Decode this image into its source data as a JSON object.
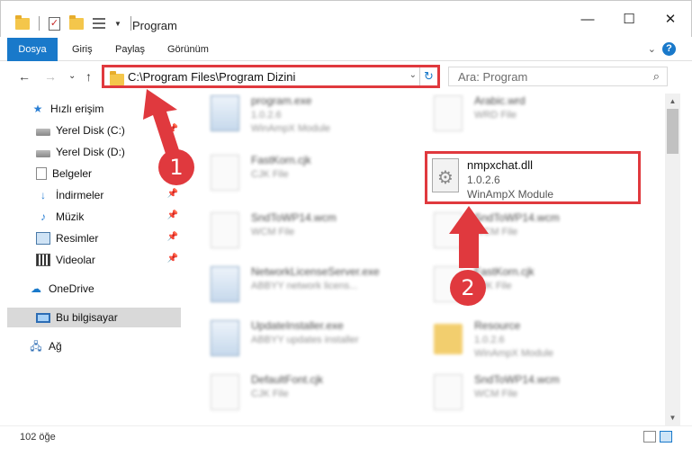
{
  "window": {
    "title": "Program",
    "minimize": "—",
    "maximize": "☐",
    "close": "✕"
  },
  "ribbon": {
    "tabs": [
      "Dosya",
      "Giriş",
      "Paylaş",
      "Görünüm"
    ],
    "collapse": "⌄",
    "help": "?"
  },
  "nav": {
    "back": "←",
    "forward": "→",
    "recent": "⌄",
    "up": "↑",
    "address": "C:\\Program Files\\Program Dizini",
    "address_dropdown": "⌄",
    "refresh": "↻",
    "search_placeholder": "Ara: Program",
    "search_icon": "⌕"
  },
  "sidebar": {
    "items": [
      {
        "label": "Hızlı erişim",
        "icon": "star-icon",
        "pinned": false
      },
      {
        "label": "Yerel Disk (C:)",
        "icon": "disk-icon",
        "pinned": true
      },
      {
        "label": "Yerel Disk (D:)",
        "icon": "disk-icon",
        "pinned": false
      },
      {
        "label": "Belgeler",
        "icon": "documents-icon",
        "pinned": true
      },
      {
        "label": "İndirmeler",
        "icon": "download-icon",
        "pinned": true
      },
      {
        "label": "Müzik",
        "icon": "music-icon",
        "pinned": true
      },
      {
        "label": "Resimler",
        "icon": "pictures-icon",
        "pinned": true
      },
      {
        "label": "Videolar",
        "icon": "videos-icon",
        "pinned": true
      },
      {
        "label": "OneDrive",
        "icon": "cloud-icon",
        "pinned": false
      },
      {
        "label": "Bu bilgisayar",
        "icon": "computer-icon",
        "pinned": false,
        "selected": true
      },
      {
        "label": "Ağ",
        "icon": "network-icon",
        "pinned": false
      }
    ],
    "pin_glyph": "📌"
  },
  "files": [
    {
      "name": "program.exe",
      "line2": "1.0.2.6",
      "line3": "WinAmpX Module",
      "icon": "exe-icon"
    },
    {
      "name": "Arabic.wrd",
      "line2": "WRD File",
      "line3": "",
      "icon": "file-icon"
    },
    {
      "name": "FastKorn.cjk",
      "line2": "CJK File",
      "line3": "",
      "icon": "file-icon"
    },
    {
      "name": "nmpxchat.dll",
      "line2": "1.0.2.6",
      "line3": "WinAmpX Module",
      "icon": "dll-gear-icon",
      "highlighted": true
    },
    {
      "name": "SndToWP14.wcm",
      "line2": "WCM File",
      "line3": "",
      "icon": "file-icon"
    },
    {
      "name": "SndToWP14.wcm",
      "line2": "WCM File",
      "line3": "",
      "icon": "file-icon"
    },
    {
      "name": "NetworkLicenseServer.exe",
      "line2": "ABBYY network licens...",
      "line3": "",
      "icon": "exe-icon"
    },
    {
      "name": "FastKorn.cjk",
      "line2": "CJK File",
      "line3": "",
      "icon": "file-icon"
    },
    {
      "name": "UpdateInstaller.exe",
      "line2": "ABBYY updates installer",
      "line3": "",
      "icon": "exe-icon"
    },
    {
      "name": "Resource",
      "line2": "1.0.2.6",
      "line3": "WinAmpX Module",
      "icon": "folder-icon"
    },
    {
      "name": "DefaultFont.cjk",
      "line2": "CJK File",
      "line3": "",
      "icon": "file-icon"
    },
    {
      "name": "SndToWP14.wcm",
      "line2": "WCM File",
      "line3": "",
      "icon": "file-icon"
    }
  ],
  "status": {
    "count": "102 öğe"
  },
  "annotations": {
    "step1": "1",
    "step2": "2",
    "color": "#e0393e"
  }
}
